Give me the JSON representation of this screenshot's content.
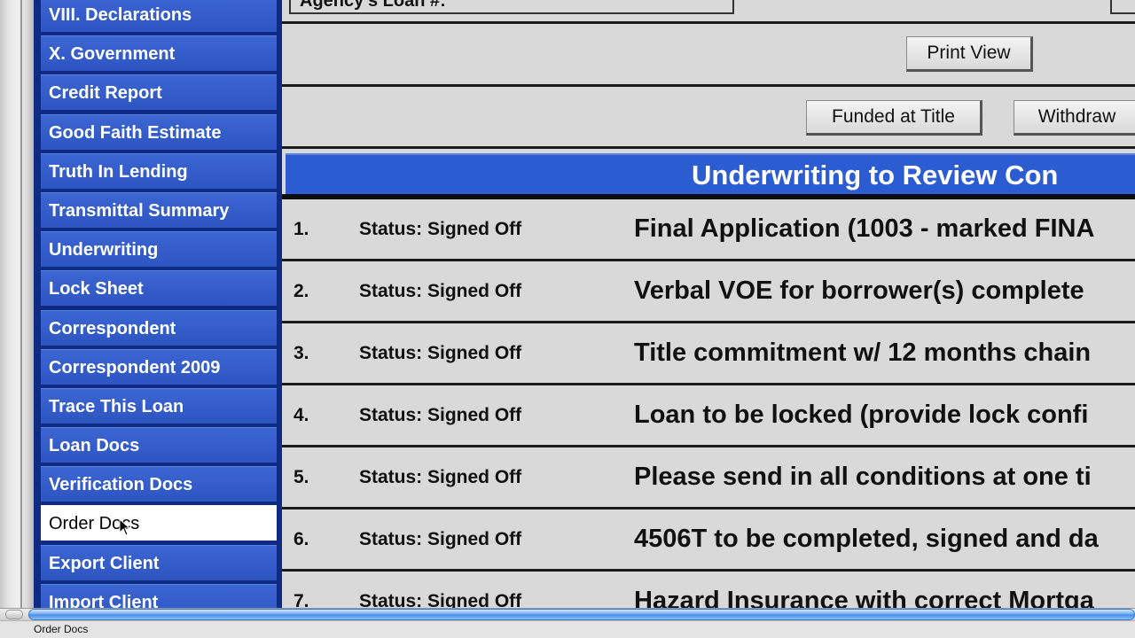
{
  "sidebar": {
    "items": [
      {
        "label": "VIII. Declarations",
        "selected": false
      },
      {
        "label": "X. Government",
        "selected": false
      },
      {
        "label": "Credit Report",
        "selected": false
      },
      {
        "label": "Good Faith Estimate",
        "selected": false
      },
      {
        "label": "Truth In Lending",
        "selected": false
      },
      {
        "label": "Transmittal Summary",
        "selected": false
      },
      {
        "label": "Underwriting",
        "selected": false
      },
      {
        "label": "Lock Sheet",
        "selected": false
      },
      {
        "label": "Correspondent",
        "selected": false
      },
      {
        "label": "Correspondent 2009",
        "selected": false
      },
      {
        "label": "Trace This Loan",
        "selected": false
      },
      {
        "label": "Loan Docs",
        "selected": false
      },
      {
        "label": "Verification Docs",
        "selected": false
      },
      {
        "label": "Order Docs",
        "selected": true
      },
      {
        "label": "Export Client",
        "selected": false
      },
      {
        "label": "Import Client",
        "selected": false
      }
    ]
  },
  "main": {
    "loan_field_label": "Agency's Loan #:",
    "print_view_label": "Print View",
    "funded_label": "Funded at Title",
    "withdraw_label": "Withdraw",
    "banner_title": "Underwriting to Review Con",
    "conditions": [
      {
        "num": "1.",
        "status": "Status: Signed Off",
        "desc": "Final Application (1003 - marked FINA"
      },
      {
        "num": "2.",
        "status": "Status: Signed Off",
        "desc": "Verbal VOE for borrower(s) complete"
      },
      {
        "num": "3.",
        "status": "Status: Signed Off",
        "desc": "Title commitment w/ 12 months chain"
      },
      {
        "num": "4.",
        "status": "Status: Signed Off",
        "desc": "Loan to be locked (provide lock confi"
      },
      {
        "num": "5.",
        "status": "Status: Signed Off",
        "desc": "Please send in all conditions at one ti"
      },
      {
        "num": "6.",
        "status": "Status: Signed Off",
        "desc": "4506T to be completed, signed and da"
      },
      {
        "num": "7.",
        "status": "Status: Signed Off",
        "desc": "Hazard Insurance with correct Mortga"
      }
    ]
  },
  "statusbar": {
    "text": "Order Docs"
  },
  "colors": {
    "sidebar_item": "#3c66d2",
    "sidebar_bg": "#0e2a82",
    "banner": "#2c5cd2",
    "main_bg": "#d9d9d9"
  }
}
